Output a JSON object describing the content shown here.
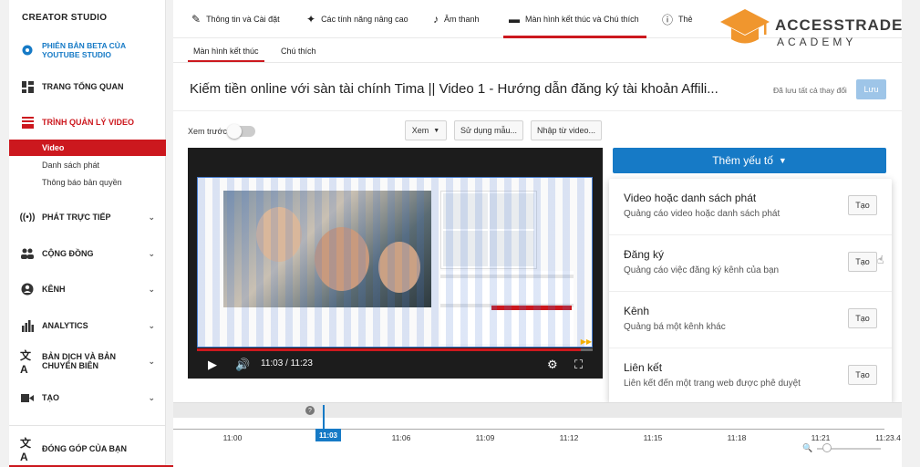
{
  "sidebar": {
    "brand": "CREATOR STUDIO",
    "beta_line1": "PHIÊN BẢN BETA CỦA",
    "beta_line2": "YOUTUBE STUDIO",
    "items": [
      {
        "label": "TRANG TỔNG QUAN",
        "icon": "dashboard-icon"
      },
      {
        "label": "TRÌNH QUẢN LÝ VIDEO",
        "icon": "video-manager-icon"
      },
      {
        "label": "PHÁT TRỰC TIẾP",
        "icon": "live-icon"
      },
      {
        "label": "CỘNG ĐỒNG",
        "icon": "community-icon"
      },
      {
        "label": "KÊNH",
        "icon": "channel-icon"
      },
      {
        "label": "ANALYTICS",
        "icon": "analytics-icon"
      },
      {
        "label": "BẢN DỊCH VÀ BẢN CHUYỂN BIÊN",
        "icon": "translate-icon"
      },
      {
        "label": "TẠO",
        "icon": "create-icon"
      },
      {
        "label": "ĐÓNG GÓP CỦA BẠN",
        "icon": "contribution-icon"
      }
    ],
    "sub_items": [
      "Video",
      "Danh sách phát",
      "Thông báo bản quyền"
    ]
  },
  "tabs": [
    {
      "label": "Thông tin và Cài đặt",
      "icon": "pencil-icon"
    },
    {
      "label": "Các tính năng nâng cao",
      "icon": "magic-wand-icon"
    },
    {
      "label": "Âm thanh",
      "icon": "music-note-icon"
    },
    {
      "label": "Màn hình kết thúc và Chú thích",
      "icon": "end-screen-icon"
    },
    {
      "label": "Thẻ",
      "icon": "info-icon"
    }
  ],
  "subtabs": [
    "Màn hình kết thúc",
    "Chú thích"
  ],
  "video": {
    "title": "Kiếm tiền online với sàn tài chính Tima || Video 1 - Hướng dẫn đăng ký tài khoản Affili...",
    "saved_text": "Đã lưu tất cả thay đổi",
    "save_label": "Lưu",
    "current_time": "11:03",
    "duration": "11:23",
    "time_display": "11:03 / 11:23",
    "progress": 0.97
  },
  "toolbar": {
    "preview_label": "Xem trước",
    "view_label": "Xem",
    "use_template_label": "Sử dụng mẫu...",
    "import_label": "Nhập từ video..."
  },
  "add_element": {
    "label": "Thêm yếu tố",
    "items": [
      {
        "title": "Video hoặc danh sách phát",
        "desc": "Quảng cáo video hoặc danh sách phát",
        "button": "Tạo"
      },
      {
        "title": "Đăng ký",
        "desc": "Quảng cáo việc đăng ký kênh của bạn",
        "button": "Tạo"
      },
      {
        "title": "Kênh",
        "desc": "Quảng bá một kênh khác",
        "button": "Tạo"
      },
      {
        "title": "Liên kết",
        "desc": "Liên kết đến một trang web được phê duyệt",
        "button": "Tạo"
      }
    ]
  },
  "timeline": {
    "ticks": [
      "11:00",
      "11:03",
      "11:06",
      "11:09",
      "11:12",
      "11:15",
      "11:18",
      "11:21",
      "11:23.4"
    ],
    "playhead": "11:03",
    "help": "?"
  },
  "logo": {
    "line1": "ACCESSTRADE",
    "line2": "ACADEMY",
    "color": "#f0962e"
  },
  "colors": {
    "accent": "#cc181e",
    "primary": "#167ac6"
  }
}
